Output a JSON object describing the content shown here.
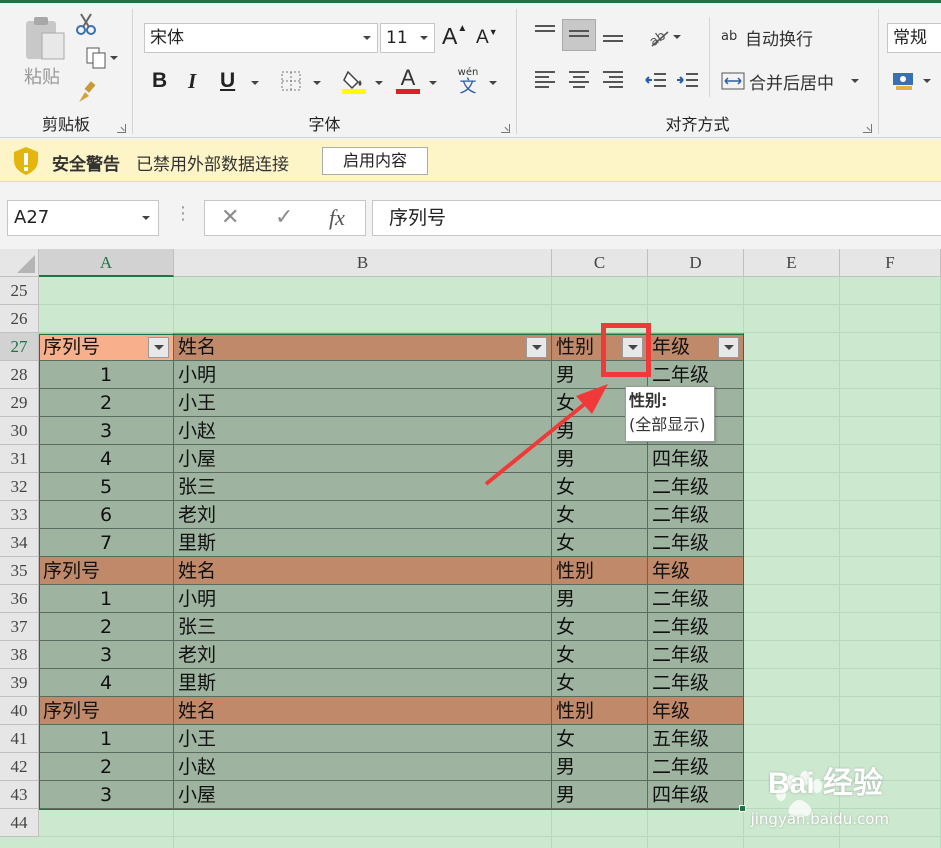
{
  "ribbon": {
    "clipboard": {
      "group_label": "剪贴板",
      "paste_label": "粘贴"
    },
    "font": {
      "group_label": "字体",
      "font_name": "宋体",
      "font_size": "11",
      "bold": "B",
      "italic": "I",
      "underline": "U",
      "font_color_glyph": "A",
      "grow_glyph": "A",
      "shrink_glyph": "A",
      "phonetic_top": "wén",
      "phonetic_bottom": "文",
      "highlight_color": "#ffff00",
      "font_color": "#e02020"
    },
    "alignment": {
      "group_label": "对齐方式",
      "wrap_text": "自动换行",
      "merge_center": "合并后居中",
      "wrap_icon_text": "ab"
    },
    "number": {
      "format": "常规"
    }
  },
  "security_bar": {
    "title": "安全警告",
    "message": "已禁用外部数据连接",
    "button": "启用内容"
  },
  "formula_bar": {
    "name_box": "A27",
    "fx": "fx",
    "cancel": "✕",
    "enter": "✓",
    "formula": "序列号"
  },
  "grid": {
    "columns": [
      "A",
      "B",
      "C",
      "D",
      "E",
      "F"
    ],
    "rows": [
      "25",
      "26",
      "27",
      "28",
      "29",
      "30",
      "31",
      "32",
      "33",
      "34",
      "35",
      "36",
      "37",
      "38",
      "39",
      "40",
      "41",
      "42",
      "43",
      "44"
    ]
  },
  "table": {
    "header": [
      "序列号",
      "姓名",
      "性别",
      "年级"
    ],
    "rows": [
      {
        "type": "header",
        "cells": [
          "序列号",
          "姓名",
          "性别",
          "年级"
        ]
      },
      {
        "type": "data",
        "cells": [
          "1",
          "小明",
          "男",
          "二年级"
        ]
      },
      {
        "type": "data",
        "cells": [
          "2",
          "小王",
          "女",
          ""
        ]
      },
      {
        "type": "data",
        "cells": [
          "3",
          "小赵",
          "男",
          ""
        ]
      },
      {
        "type": "data",
        "cells": [
          "4",
          "小屋",
          "男",
          "四年级"
        ]
      },
      {
        "type": "data",
        "cells": [
          "5",
          "张三",
          "女",
          "二年级"
        ]
      },
      {
        "type": "data",
        "cells": [
          "6",
          "老刘",
          "女",
          "二年级"
        ]
      },
      {
        "type": "data",
        "cells": [
          "7",
          "里斯",
          "女",
          "二年级"
        ]
      },
      {
        "type": "header",
        "cells": [
          "序列号",
          "姓名",
          "性别",
          "年级"
        ]
      },
      {
        "type": "data",
        "cells": [
          "1",
          "小明",
          "男",
          "二年级"
        ]
      },
      {
        "type": "data",
        "cells": [
          "2",
          "张三",
          "女",
          "二年级"
        ]
      },
      {
        "type": "data",
        "cells": [
          "3",
          "老刘",
          "女",
          "二年级"
        ]
      },
      {
        "type": "data",
        "cells": [
          "4",
          "里斯",
          "女",
          "二年级"
        ]
      },
      {
        "type": "header",
        "cells": [
          "序列号",
          "姓名",
          "性别",
          "年级"
        ]
      },
      {
        "type": "data",
        "cells": [
          "1",
          "小王",
          "女",
          "五年级"
        ]
      },
      {
        "type": "data",
        "cells": [
          "2",
          "小赵",
          "男",
          "二年级"
        ]
      },
      {
        "type": "data",
        "cells": [
          "3",
          "小屋",
          "男",
          "四年级"
        ]
      }
    ]
  },
  "tooltip": {
    "title": "性别:",
    "body": "(全部显示)"
  },
  "watermark": {
    "text": "Bai  经验",
    "sub": "jingyan.baidu.com"
  },
  "colors": {
    "accent": "#217346",
    "header_row": "#c08a6a",
    "first_header_cell": "#f8b08c",
    "data_row": "#9eb4a0",
    "sheet_bg": "#cce8cf",
    "annotation_red": "#f03a3a"
  }
}
